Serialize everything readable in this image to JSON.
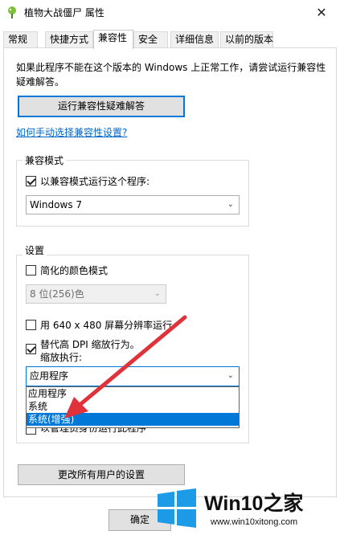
{
  "window": {
    "title": "植物大战僵尸 属性",
    "close_glyph": "✕"
  },
  "tabs": [
    {
      "label": "常规"
    },
    {
      "label": "快捷方式"
    },
    {
      "label": "兼容性"
    },
    {
      "label": "安全"
    },
    {
      "label": "详细信息"
    },
    {
      "label": "以前的版本"
    }
  ],
  "intro": {
    "text": "如果此程序不能在这个版本的 Windows 上正常工作，请尝试运行兼容性疑难解答。",
    "troubleshoot_button": "运行兼容性疑难解答",
    "manual_link": "如何手动选择兼容性设置?"
  },
  "compat_mode": {
    "group_label": "兼容模式",
    "checkbox_label": "以兼容模式运行这个程序:",
    "selected": "Windows 7"
  },
  "settings": {
    "group_label": "设置",
    "reduced_color_label": "简化的颜色模式",
    "color_depth": "8 位(256)色",
    "resolution_label": "用 640 x 480 屏幕分辨率运行",
    "dpi_override_label": "替代高 DPI 缩放行为。",
    "scaling_label": "缩放执行:",
    "scaling_selected": "应用程序",
    "scaling_options": [
      "应用程序",
      "系统",
      "系统(增强)"
    ],
    "admin_label_partial": "以管理员身份运行此程序"
  },
  "change_all_button": "更改所有用户的设置",
  "ok_button": "确定",
  "watermark": {
    "brand": "Win10之家",
    "url": "www.win10xitong.com"
  },
  "colors": {
    "accent": "#0078d7",
    "arrow": "#e0323a"
  }
}
